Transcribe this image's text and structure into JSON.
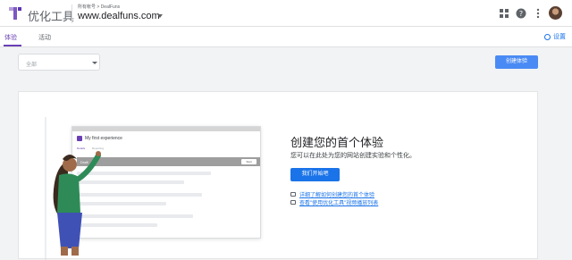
{
  "header": {
    "product_name": "优化工具",
    "account_label": "所有帐号 > DealFuns",
    "container_name": "www.dealfuns.com"
  },
  "tabs": [
    {
      "label": "体验",
      "active": true
    },
    {
      "label": "活动",
      "active": false
    }
  ],
  "settings_label": "设置",
  "filter": {
    "selected": "全部"
  },
  "create_button_label": "创建体验",
  "empty_state": {
    "title": "创建您的首个体验",
    "subtitle": "您可以在此处为您的网站创建实验和个性化。",
    "start_button_label": "我们开始吧",
    "links": [
      {
        "label": "详细了解如何创建您的首个体验",
        "icon": "graduation-cap-icon"
      },
      {
        "label": "查看\"使用优化工具\"视频播放列表",
        "icon": "video-icon"
      }
    ]
  },
  "illustration": {
    "window_title": "My first experience",
    "tab_1": "Details",
    "tab_2": "Reporting",
    "bar_text": "Draft",
    "bar_button": "Start"
  },
  "colors": {
    "brand_purple": "#6a3fb5",
    "primary_blue": "#1a73e8",
    "button_blue": "#4a8af4"
  }
}
